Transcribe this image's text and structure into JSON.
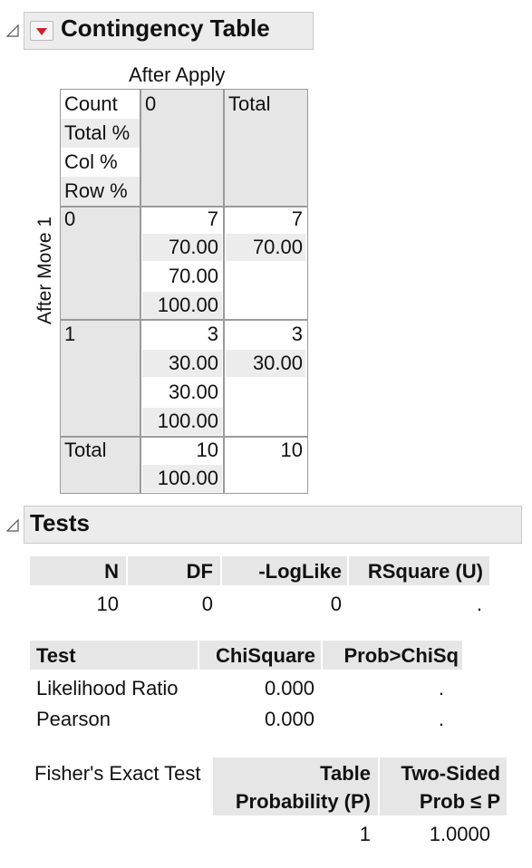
{
  "contingency": {
    "title": "Contingency Table",
    "col_var": "After Apply",
    "row_var": "After Move 1",
    "legend": [
      "Count",
      "Total %",
      "Col %",
      "Row %"
    ],
    "col_headers": [
      "0",
      "Total"
    ],
    "rows": [
      {
        "label": "0",
        "cell": [
          "7",
          "70.00",
          "70.00",
          "100.00"
        ],
        "total": [
          "7",
          "70.00"
        ]
      },
      {
        "label": "1",
        "cell": [
          "3",
          "30.00",
          "30.00",
          "100.00"
        ],
        "total": [
          "3",
          "30.00"
        ]
      }
    ],
    "total_row": {
      "label": "Total",
      "cell": [
        "10",
        "100.00"
      ],
      "total": [
        "10"
      ]
    }
  },
  "tests": {
    "title": "Tests",
    "summary_headers": [
      "N",
      "DF",
      "-LogLike",
      "RSquare (U)"
    ],
    "summary_values": [
      "10",
      "0",
      "0",
      "."
    ],
    "chi_headers": [
      "Test",
      "ChiSquare",
      "Prob>ChiSq"
    ],
    "chi_rows": [
      {
        "test": "Likelihood Ratio",
        "chisq": "0.000",
        "prob": "."
      },
      {
        "test": "Pearson",
        "chisq": "0.000",
        "prob": "."
      }
    ],
    "fisher": {
      "label": "Fisher's Exact Test",
      "col1_line1": "Table",
      "col1_line2": "Probability (P)",
      "col2_line1": "Two-Sided",
      "col2_line2": "Prob ≤ P",
      "values": [
        "1",
        "1.0000"
      ]
    }
  },
  "colors": {
    "menu_arrow": "#d0202a",
    "header_bg": "#ececec",
    "cell_bg": "#e6e6e6"
  }
}
